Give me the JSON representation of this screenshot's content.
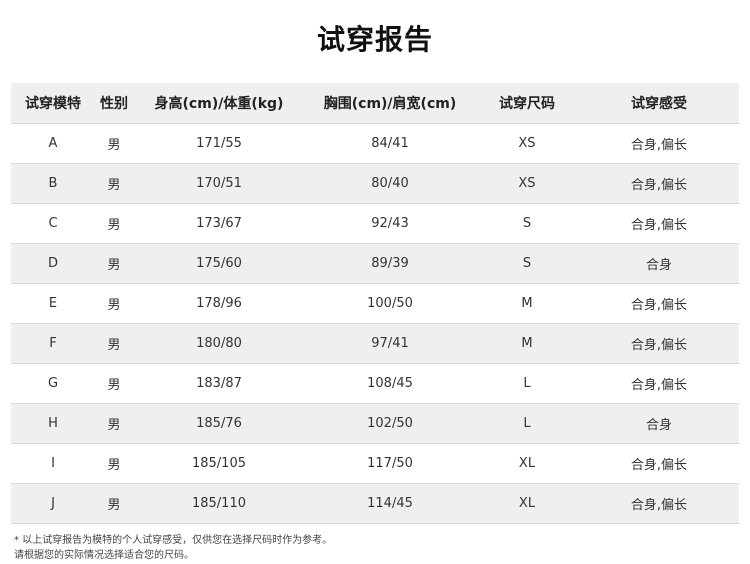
{
  "title": "试穿报告",
  "table": {
    "headers": [
      "试穿模特",
      "性别",
      "身高(cm)/体重(kg)",
      "胸围(cm)/肩宽(cm)",
      "试穿尺码",
      "试穿感受"
    ],
    "rows": [
      [
        "A",
        "男",
        "171/55",
        "84/41",
        "XS",
        "合身,偏长"
      ],
      [
        "B",
        "男",
        "170/51",
        "80/40",
        "XS",
        "合身,偏长"
      ],
      [
        "C",
        "男",
        "173/67",
        "92/43",
        "S",
        "合身,偏长"
      ],
      [
        "D",
        "男",
        "175/60",
        "89/39",
        "S",
        "合身"
      ],
      [
        "E",
        "男",
        "178/96",
        "100/50",
        "M",
        "合身,偏长"
      ],
      [
        "F",
        "男",
        "180/80",
        "97/41",
        "M",
        "合身,偏长"
      ],
      [
        "G",
        "男",
        "183/87",
        "108/45",
        "L",
        "合身,偏长"
      ],
      [
        "H",
        "男",
        "185/76",
        "102/50",
        "L",
        "合身"
      ],
      [
        "I",
        "男",
        "185/105",
        "117/50",
        "XL",
        "合身,偏长"
      ],
      [
        "J",
        "男",
        "185/110",
        "114/45",
        "XL",
        "合身,偏长"
      ]
    ]
  },
  "notes": {
    "line1": "* 以上试穿报告为模特的个人试穿感受，仅供您在选择尺码时作为参考。",
    "line2": "请根据您的实际情况选择适合您的尺码。"
  }
}
